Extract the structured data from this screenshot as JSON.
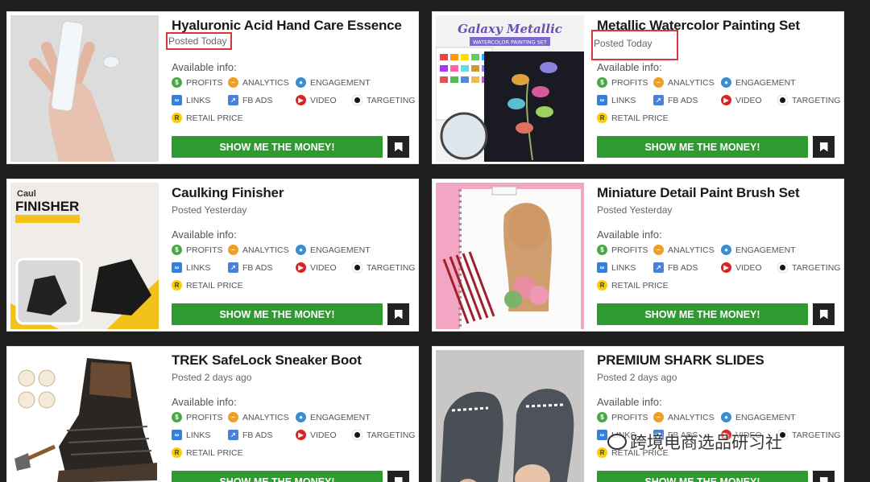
{
  "available_label": "Available info:",
  "features": {
    "profits": "PROFITS",
    "analytics": "ANALYTICS",
    "engagement": "ENGAGEMENT",
    "links": "LINKS",
    "fb_ads": "FB ADS",
    "video": "VIDEO",
    "targeting": "TARGETING",
    "retail_price": "RETAIL PRICE"
  },
  "button_label": "SHOW ME THE MONEY!",
  "products": [
    {
      "title": "Hyaluronic Acid Hand Care Essence",
      "posted": "Posted Today"
    },
    {
      "title": "Metallic Watercolor Painting Set",
      "posted": "Posted Today",
      "image_text": "Galaxy Metallic",
      "image_subtext": "WATERCOLOR PAINTING SET"
    },
    {
      "title": "Caulking Finisher",
      "posted": "Posted Yesterday",
      "image_text_1": "Caul",
      "image_text_2": "FINISHER"
    },
    {
      "title": "Miniature Detail Paint Brush Set",
      "posted": "Posted Yesterday"
    },
    {
      "title": "TREK SafeLock Sneaker Boot",
      "posted": "Posted 2 days ago"
    },
    {
      "title": "PREMIUM SHARK SLIDES",
      "posted": "Posted 2 days ago"
    }
  ],
  "watermark": "跨境电商选品研习社",
  "colors": {
    "accent_green": "#2f9a2f",
    "highlight_red": "#d9363e",
    "background": "#1f1f1f"
  }
}
